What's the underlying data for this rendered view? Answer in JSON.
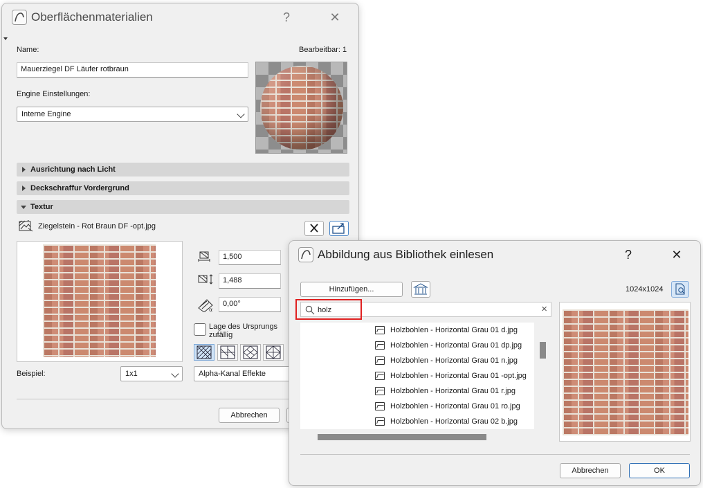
{
  "dialog1": {
    "title": "Oberflächenmaterialien",
    "help": "?",
    "close": "✕",
    "name_label": "Name:",
    "editable_label": "Bearbeitbar: 1",
    "name_value": "Mauerziegel DF Läufer rotbraun",
    "engine_label": "Engine Einstellungen:",
    "engine_value": "Interne Engine",
    "sections": [
      {
        "label": "Ausrichtung nach Licht",
        "expanded": false
      },
      {
        "label": "Deckschraffur Vordergrund",
        "expanded": false
      },
      {
        "label": "Textur",
        "expanded": true
      }
    ],
    "texture_file": "Ziegelstein - Rot Braun DF -opt.jpg",
    "width_value": "1,500",
    "height_value": "1,488",
    "angle_value": "0,00°",
    "random_origin_label": "Lage des Ursprungs zufällig",
    "random_origin_checked": false,
    "example_label": "Beispiel:",
    "example_value": "1x1",
    "alpha_value": "Alpha-Kanal Effekte",
    "cancel_label": "Abbrechen"
  },
  "dialog2": {
    "title": "Abbildung aus Bibliothek einlesen",
    "help": "?",
    "close": "✕",
    "add_label": "Hinzufügen...",
    "resolution": "1024x1024",
    "search_value": "holz",
    "clear": "×",
    "files": [
      "Holzbohlen - Horizontal Grau 01 d.jpg",
      "Holzbohlen - Horizontal Grau 01 dp.jpg",
      "Holzbohlen - Horizontal Grau 01 n.jpg",
      "Holzbohlen - Horizontal Grau 01 -opt.jpg",
      "Holzbohlen - Horizontal Grau 01 r.jpg",
      "Holzbohlen - Horizontal Grau 01 ro.jpg",
      "Holzbohlen - Horizontal Grau 02 b.jpg"
    ],
    "cancel_label": "Abbrechen",
    "ok_label": "OK"
  },
  "colors": {
    "highlight": "#e02020",
    "primary_border": "#2f6fb5",
    "selected_hatch": "#cfe3f7"
  }
}
